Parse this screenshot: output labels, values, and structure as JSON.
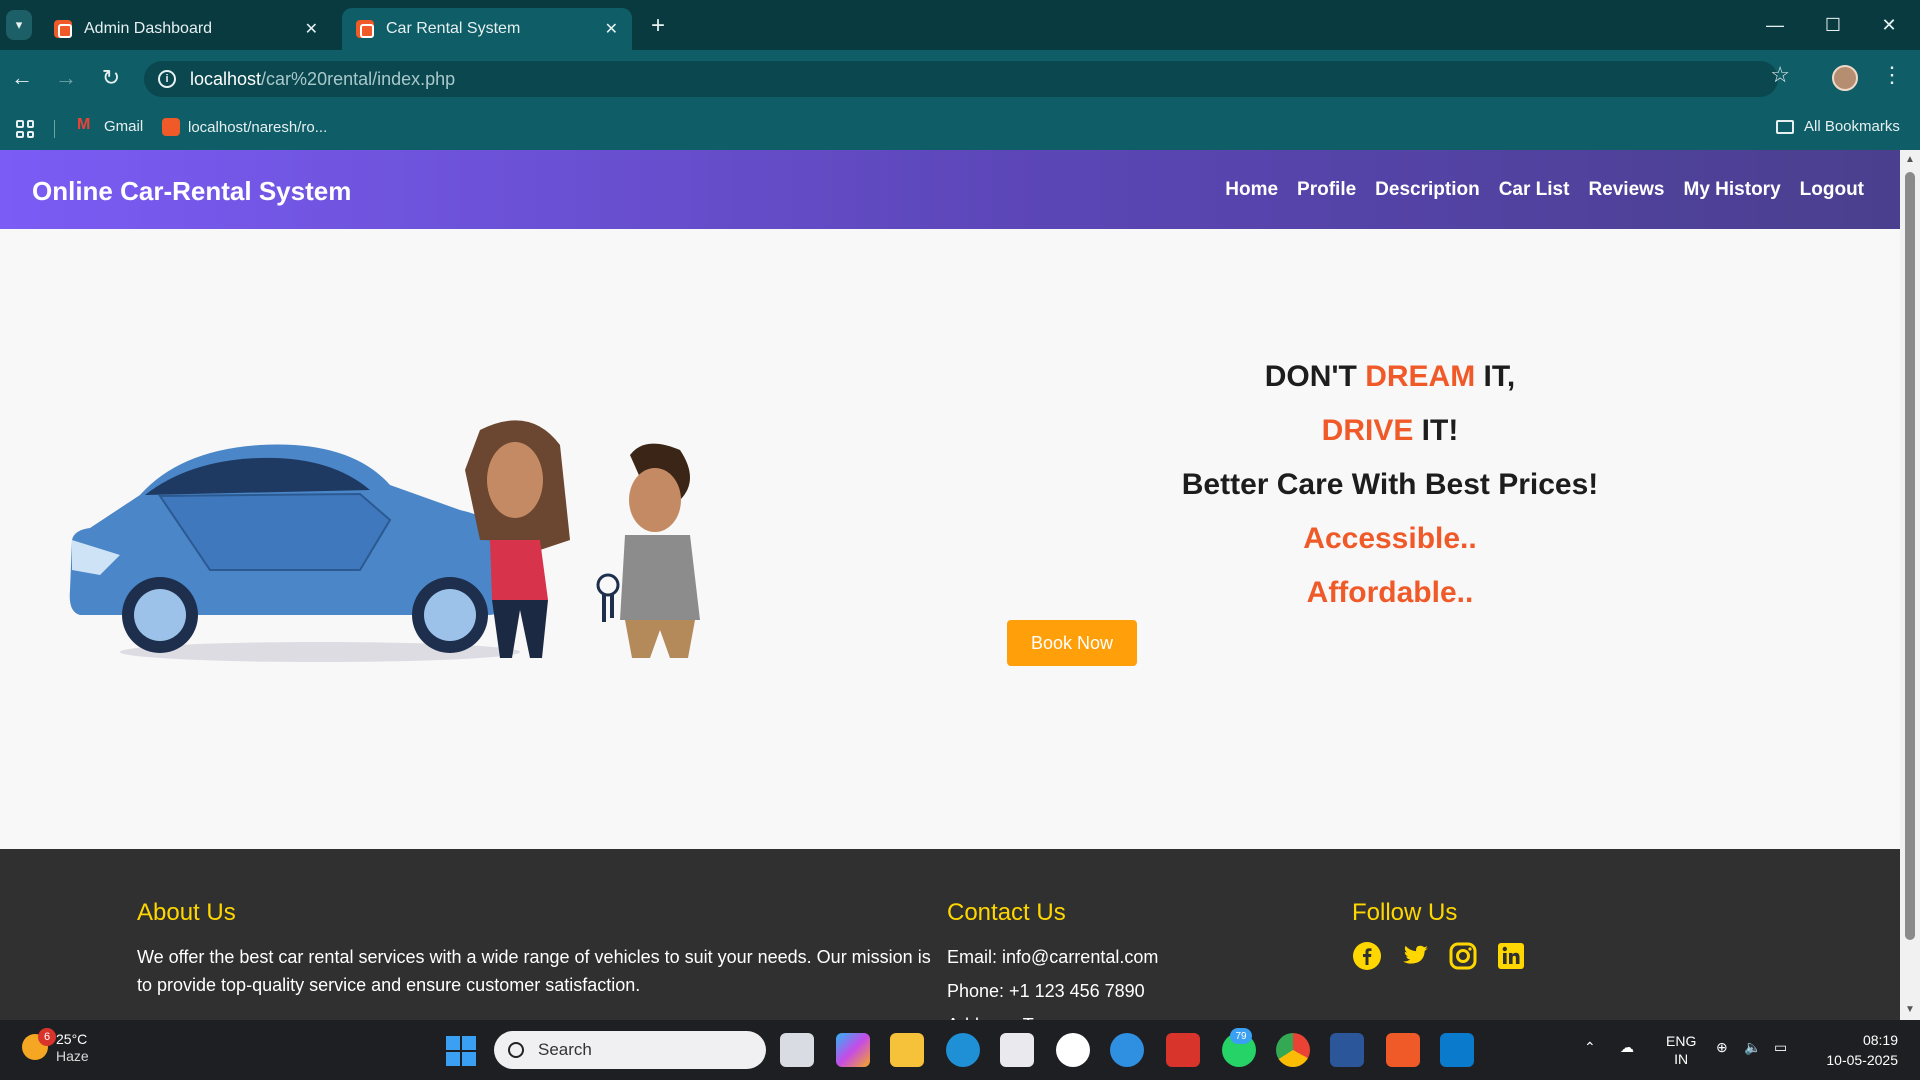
{
  "browser": {
    "tabs": [
      {
        "title": "Admin Dashboard",
        "active": false
      },
      {
        "title": "Car Rental System",
        "active": true
      }
    ],
    "url_host": "localhost",
    "url_path": "/car%20rental/index.php",
    "bookmarks": [
      "Gmail",
      "localhost/naresh/ro..."
    ],
    "all_bookmarks_label": "All Bookmarks"
  },
  "site": {
    "brand": "Online Car-Rental System",
    "nav": [
      "Home",
      "Profile",
      "Description",
      "Car List",
      "Reviews",
      "My History",
      "Logout"
    ],
    "hero": {
      "line1_a": "DON'T ",
      "line1_b": "DREAM",
      "line1_c": " IT,",
      "line2_a": "DRIVE",
      "line2_b": " IT!",
      "line3": "Better Care With Best Prices!",
      "line4": "Accessible..",
      "line5": "Affordable..",
      "cta": "Book Now"
    },
    "footer": {
      "about_title": "About Us",
      "about_text": "We offer the best car rental services with a wide range of vehicles to suit your needs. Our mission is to provide top-quality service and ensure customer satisfaction.",
      "contact_title": "Contact Us",
      "email": "Email: info@carrental.com",
      "phone": "Phone: +1 123 456 7890",
      "address": "Address: Ts",
      "follow_title": "Follow Us",
      "social": [
        "facebook-icon",
        "twitter-icon",
        "instagram-icon",
        "linkedin-icon"
      ]
    },
    "colors": {
      "accent": "#f05a28",
      "cta": "#ff9f0a",
      "footer_heading": "#ffd700"
    }
  },
  "taskbar": {
    "weather_badge": "6",
    "temperature": "25°C",
    "condition": "Haze",
    "search_placeholder": "Search",
    "whatsapp_badge": "79",
    "lang": "ENG",
    "region": "IN",
    "time": "08:19",
    "date": "10-05-2025"
  }
}
